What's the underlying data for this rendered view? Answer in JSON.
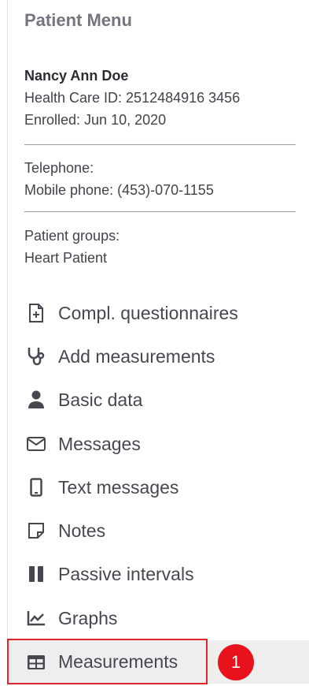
{
  "menu": {
    "title": "Patient Menu"
  },
  "patient": {
    "name": "Nancy Ann Doe",
    "health_care_id": "Health Care ID: 2512484916 3456",
    "enrolled": "Enrolled: Jun 10, 2020",
    "telephone": "Telephone:",
    "mobile": "Mobile phone: (453)-070-1155",
    "groups_label": "Patient groups:",
    "groups_value": "Heart Patient"
  },
  "nav": {
    "items": [
      {
        "label": "Compl. questionnaires",
        "icon": "questionnaire-icon"
      },
      {
        "label": "Add measurements",
        "icon": "stethoscope-icon"
      },
      {
        "label": "Basic data",
        "icon": "user-icon"
      },
      {
        "label": "Messages",
        "icon": "envelope-icon"
      },
      {
        "label": "Text messages",
        "icon": "mobile-phone-icon"
      },
      {
        "label": "Notes",
        "icon": "note-icon"
      },
      {
        "label": "Passive intervals",
        "icon": "pause-icon"
      },
      {
        "label": "Graphs",
        "icon": "chart-icon"
      },
      {
        "label": "Measurements",
        "icon": "table-icon",
        "active": true
      }
    ]
  },
  "annotation": {
    "badge": "1",
    "color": "#e8121c"
  }
}
